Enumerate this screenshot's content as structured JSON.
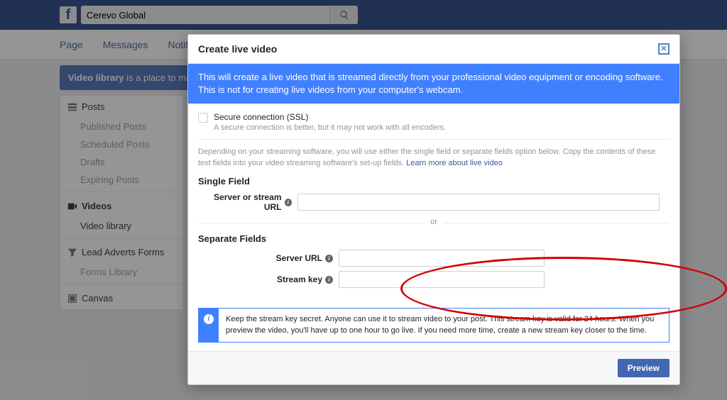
{
  "header": {
    "search_value": "Cerevo Global"
  },
  "subnav": {
    "page": "Page",
    "messages": "Messages",
    "notif": "Notif"
  },
  "notice": {
    "bold": "Video library",
    "rest": " is a place to man"
  },
  "sidebar": {
    "posts_head": "Posts",
    "posts": {
      "published": "Published Posts",
      "scheduled": "Scheduled Posts",
      "drafts": "Drafts",
      "expiring": "Expiring Posts"
    },
    "videos_head": "Videos",
    "videos": {
      "library": "Video library"
    },
    "leads_head": "Lead Adverts Forms",
    "leads": {
      "forms": "Forms Library"
    },
    "canvas_head": "Canvas"
  },
  "modal": {
    "title": "Create live video",
    "banner": "This will create a live video that is streamed directly from your professional video equipment or encoding software. This is not for creating live videos from your computer's webcam.",
    "ssl_label": "Secure connection (SSL)",
    "ssl_hint": "A secure connection is better, but it may not work with all encoders.",
    "depending": "Depending on your streaming software, you will use either the single field or separate fields option below. Copy the contents of these text fields into your video streaming software's set-up fields. ",
    "learn_link": "Learn more about live video",
    "single_title": "Single Field",
    "single_label": "Server or stream URL",
    "or": "or",
    "separate_title": "Separate Fields",
    "server_url_label": "Server URL",
    "stream_key_label": "Stream key",
    "callout": "Keep the stream key secret. Anyone can use it to stream video to your post. This stream key is valid for 24 hours. When you preview the video, you'll have up to one hour to go live. If you need more time, create a new stream key closer to the time.",
    "preview_btn": "Preview"
  }
}
